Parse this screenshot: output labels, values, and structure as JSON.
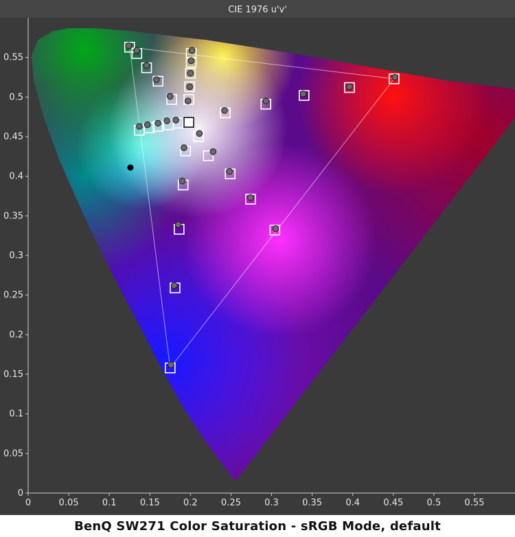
{
  "caption": "BenQ SW271 Color Saturation - sRGB Mode, default",
  "chart_data": {
    "type": "scatter",
    "title": "CIE 1976 u'v'",
    "xlabel": "",
    "ylabel": "",
    "xlim": [
      0,
      0.6
    ],
    "ylim": [
      0,
      0.6
    ],
    "x_ticks": [
      0,
      0.05,
      0.1,
      0.15,
      0.2,
      0.25,
      0.3,
      0.35,
      0.4,
      0.45,
      0.5,
      0.55
    ],
    "x_tick_labels": [
      "0",
      "0.05",
      "0.1",
      "0.15",
      "0.2",
      "0.25",
      "0.3",
      "0.35",
      "0.4",
      "0.45",
      "0.5",
      "0.55"
    ],
    "y_ticks": [
      0,
      0.05,
      0.1,
      0.15,
      0.2,
      0.25,
      0.3,
      0.35,
      0.4,
      0.45,
      0.5,
      0.55
    ],
    "y_tick_labels": [
      "0",
      "0.05",
      "0.1",
      "0.15",
      "0.2",
      "0.25",
      "0.3",
      "0.35",
      "0.4",
      "0.45",
      "0.5",
      "0.55"
    ],
    "grid": false,
    "background_color": "#3a3a3a",
    "gamut_triangle": [
      [
        0.451,
        0.523
      ],
      [
        0.125,
        0.563
      ],
      [
        0.175,
        0.158
      ]
    ],
    "white_point": [
      0.198,
      0.468
    ],
    "target_point": [
      0.126,
      0.411
    ],
    "series": [
      {
        "marker": "square",
        "color": "#ffffff",
        "values": [
          [
            0.125,
            0.563
          ],
          [
            0.134,
            0.555
          ],
          [
            0.146,
            0.537
          ],
          [
            0.16,
            0.52
          ],
          [
            0.177,
            0.497
          ],
          [
            0.137,
            0.458
          ],
          [
            0.149,
            0.461
          ],
          [
            0.16,
            0.463
          ],
          [
            0.173,
            0.465
          ],
          [
            0.185,
            0.467
          ],
          [
            0.201,
            0.555
          ],
          [
            0.201,
            0.544
          ],
          [
            0.2,
            0.53
          ],
          [
            0.199,
            0.513
          ],
          [
            0.198,
            0.497
          ],
          [
            0.21,
            0.45
          ],
          [
            0.222,
            0.426
          ],
          [
            0.249,
            0.403
          ],
          [
            0.274,
            0.371
          ],
          [
            0.304,
            0.332
          ],
          [
            0.194,
            0.432
          ],
          [
            0.191,
            0.389
          ],
          [
            0.186,
            0.333
          ],
          [
            0.181,
            0.259
          ],
          [
            0.175,
            0.158
          ],
          [
            0.243,
            0.48
          ],
          [
            0.293,
            0.491
          ],
          [
            0.34,
            0.502
          ],
          [
            0.396,
            0.512
          ],
          [
            0.451,
            0.523
          ]
        ]
      },
      {
        "marker": "circle",
        "color": "#6b6b6b",
        "values": [
          [
            0.124,
            0.565
          ],
          [
            0.134,
            0.559
          ],
          [
            0.146,
            0.54
          ],
          [
            0.158,
            0.522
          ],
          [
            0.175,
            0.501
          ],
          [
            0.137,
            0.463
          ],
          [
            0.147,
            0.465
          ],
          [
            0.16,
            0.467
          ],
          [
            0.171,
            0.47
          ],
          [
            0.182,
            0.471
          ],
          [
            0.202,
            0.559
          ],
          [
            0.201,
            0.546
          ],
          [
            0.2,
            0.53
          ],
          [
            0.199,
            0.513
          ],
          [
            0.197,
            0.495
          ],
          [
            0.211,
            0.454
          ],
          [
            0.228,
            0.431
          ],
          [
            0.248,
            0.406
          ],
          [
            0.274,
            0.373
          ],
          [
            0.305,
            0.334
          ],
          [
            0.192,
            0.436
          ],
          [
            0.19,
            0.394
          ],
          [
            0.185,
            0.339
          ],
          [
            0.18,
            0.262
          ],
          [
            0.176,
            0.162
          ],
          [
            0.242,
            0.483
          ],
          [
            0.293,
            0.495
          ],
          [
            0.339,
            0.504
          ],
          [
            0.396,
            0.513
          ],
          [
            0.452,
            0.525
          ]
        ]
      }
    ]
  }
}
